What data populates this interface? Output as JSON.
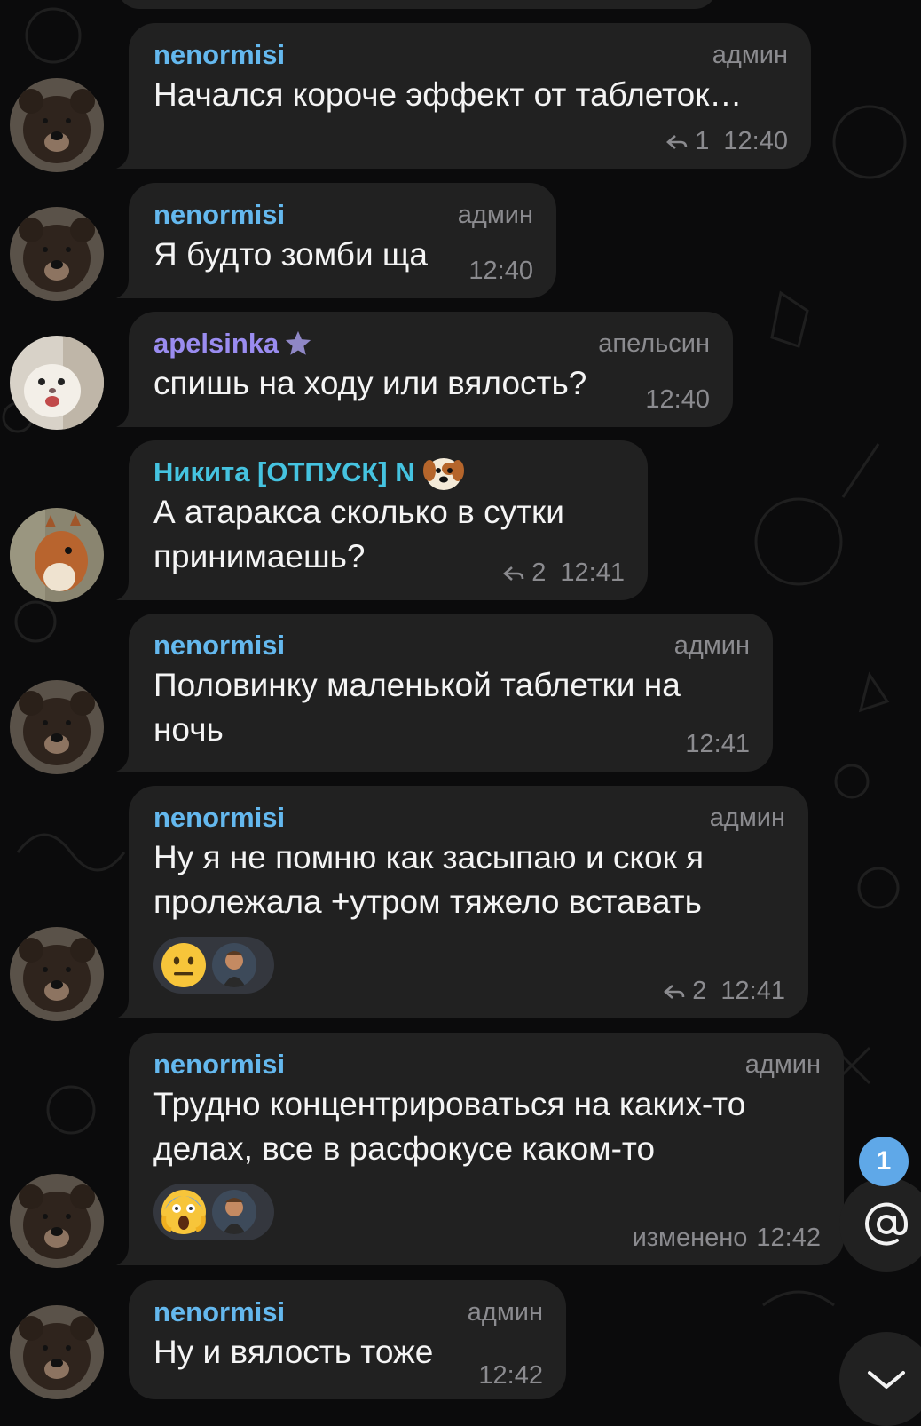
{
  "colors": {
    "background": "#0b0b0c",
    "bubble": "#212121",
    "meta_gray": "#8b8b8f",
    "name_blue": "#64b8ee",
    "name_violet": "#9a8cf0",
    "name_cyan": "#45c3e0",
    "badge_blue": "#5fa8e8"
  },
  "messages": [
    {
      "sender": "nenormisi",
      "role": "админ",
      "text": "Начался короче эффект от таблеток…",
      "replies": "1",
      "time": "12:40",
      "avatar": "bear-avatar"
    },
    {
      "sender": "nenormisi",
      "role": "админ",
      "text": "Я будто зомби ща",
      "time": "12:40",
      "avatar": "bear-avatar"
    },
    {
      "sender": "apelsinka",
      "role": "апельсин",
      "text": "спишь на ходу или вялость?",
      "time": "12:40",
      "avatar": "ferret-avatar",
      "badge": "star-icon"
    },
    {
      "sender": "Никита [ОТПУСК] N",
      "text": "А атаракса сколько в сутки\nпринимаешь?",
      "replies": "2",
      "time": "12:41",
      "avatar": "squirrel-avatar",
      "badge": "dog-emoji"
    },
    {
      "sender": "nenormisi",
      "role": "админ",
      "text": "Половинку маленькой таблетки на\nночь",
      "time": "12:41",
      "avatar": "bear-avatar"
    },
    {
      "sender": "nenormisi",
      "role": "админ",
      "text": "Ну я не помню как засыпаю и скок я\nпролежала +утром тяжело вставать",
      "reaction": "neutral-face-emoji",
      "replies": "2",
      "time": "12:41",
      "avatar": "bear-avatar"
    },
    {
      "sender": "nenormisi",
      "role": "админ",
      "text": "Трудно концентрироваться на каких-то\nделах, все в расфокусе каком-то",
      "reaction": "screaming-face-emoji",
      "edited": "изменено",
      "time": "12:42",
      "avatar": "bear-avatar"
    },
    {
      "sender": "nenormisi",
      "role": "админ",
      "text": "Ну и вялость тоже",
      "time": "12:42",
      "avatar": "bear-avatar"
    }
  ],
  "fabs": {
    "mention_count": "1",
    "mention_icon": "at-icon",
    "scroll_icon": "chevron-down-icon"
  }
}
